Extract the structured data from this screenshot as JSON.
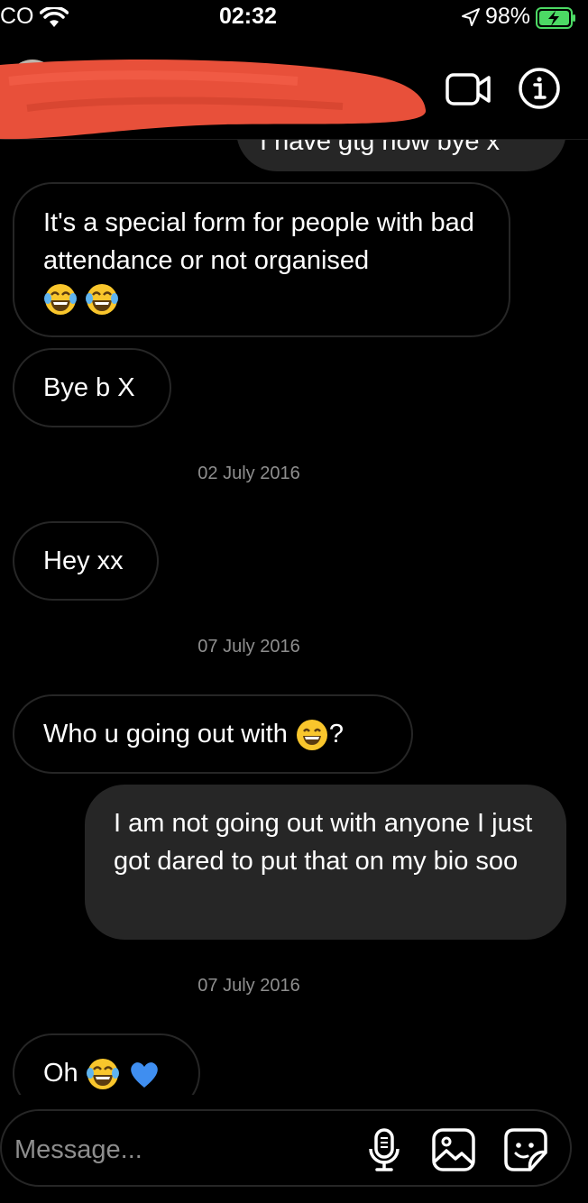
{
  "status_bar": {
    "carrier": "CO",
    "time": "02:32",
    "battery_percent": "98%"
  },
  "header": {
    "icons": [
      "avatar",
      "video-call-icon",
      "info-icon"
    ]
  },
  "conversation": {
    "partial_top_message": "I have gtg now bye x",
    "messages": [
      {
        "id": "m1",
        "direction": "incoming",
        "text": "It's a special form for people with bad attendance or not organised",
        "emojis": [
          "laughing-tears-emoji",
          "laughing-tears-emoji"
        ]
      },
      {
        "id": "m2",
        "direction": "incoming",
        "text": "Bye b X"
      },
      {
        "id": "d1",
        "type": "date",
        "text": "02 July 2016"
      },
      {
        "id": "m3",
        "direction": "incoming",
        "text": "Hey xx"
      },
      {
        "id": "d2",
        "type": "date",
        "text": "07 July 2016"
      },
      {
        "id": "m4",
        "direction": "incoming",
        "text_before": "Who u going out with",
        "emoji": "grinning-emoji",
        "text_after": "?"
      },
      {
        "id": "m5",
        "direction": "outgoing",
        "text": "I am not going out with anyone I just got dared to put that on my bio soo"
      },
      {
        "id": "d3",
        "type": "date",
        "text": "07 July 2016"
      },
      {
        "id": "m6",
        "direction": "incoming",
        "text": "Oh",
        "emojis": [
          "laughing-tears-emoji",
          "blue-heart-emoji"
        ]
      }
    ]
  },
  "composer": {
    "placeholder": "Message...",
    "icons": [
      "microphone-icon",
      "gallery-icon",
      "sticker-icon"
    ]
  },
  "colors": {
    "background": "#000000",
    "incoming_border": "#262626",
    "outgoing_fill": "#262626",
    "muted_text": "#8e8e8e",
    "battery_green": "#4cd964",
    "redaction_red": "#e8503a"
  }
}
